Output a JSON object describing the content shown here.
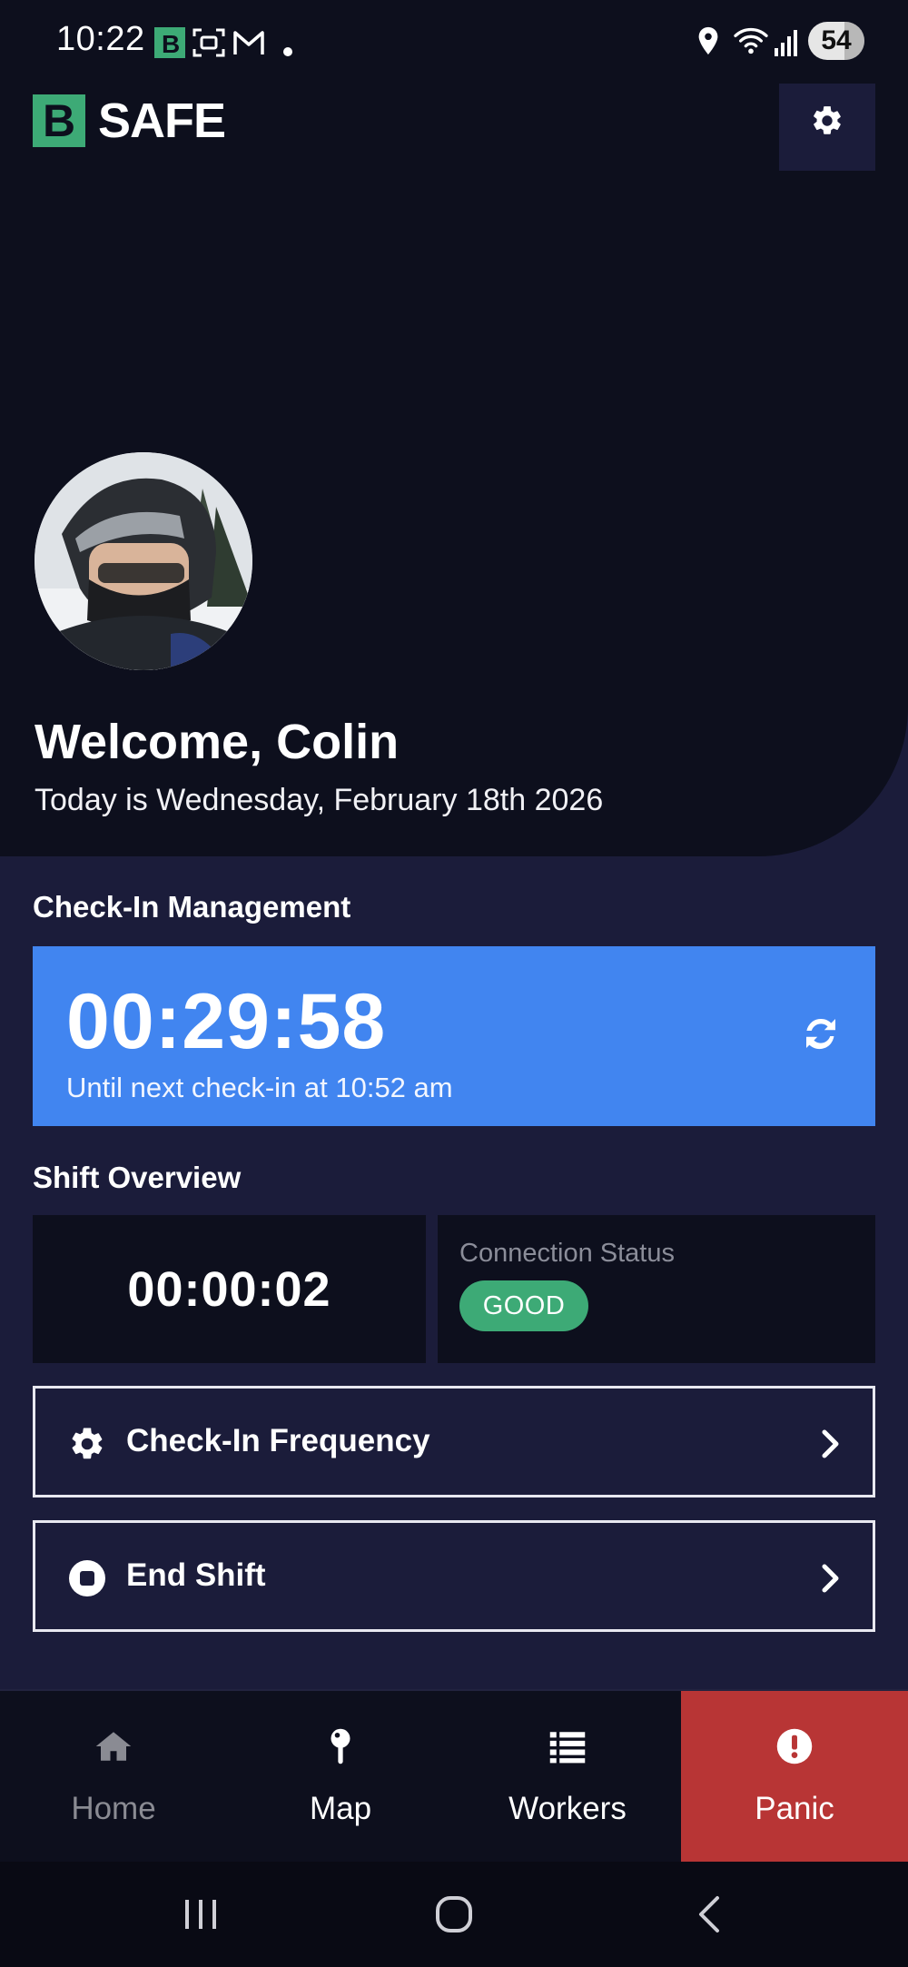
{
  "status_bar": {
    "time": "10:22",
    "battery": "54"
  },
  "app": {
    "logo_letter": "B",
    "logo_text": "SAFE"
  },
  "hero": {
    "welcome": "Welcome, Colin",
    "today": "Today is Wednesday, February 18th 2026"
  },
  "checkin": {
    "section_title": "Check-In Management",
    "countdown": "00:29:58",
    "until": "Until next check-in at 10:52 am"
  },
  "shift": {
    "section_title": "Shift Overview",
    "elapsed": "00:00:02",
    "connection_label": "Connection Status",
    "connection_status": "GOOD"
  },
  "actions": {
    "frequency": "Check-In Frequency",
    "end_shift": "End Shift"
  },
  "nav": {
    "home": "Home",
    "map": "Map",
    "workers": "Workers",
    "panic": "Panic"
  },
  "colors": {
    "background": "#1b1c3a",
    "hero": "#0d0f1d",
    "accent_blue": "#4185f0",
    "good_green": "#3daa76",
    "panic_red": "#b83535"
  }
}
